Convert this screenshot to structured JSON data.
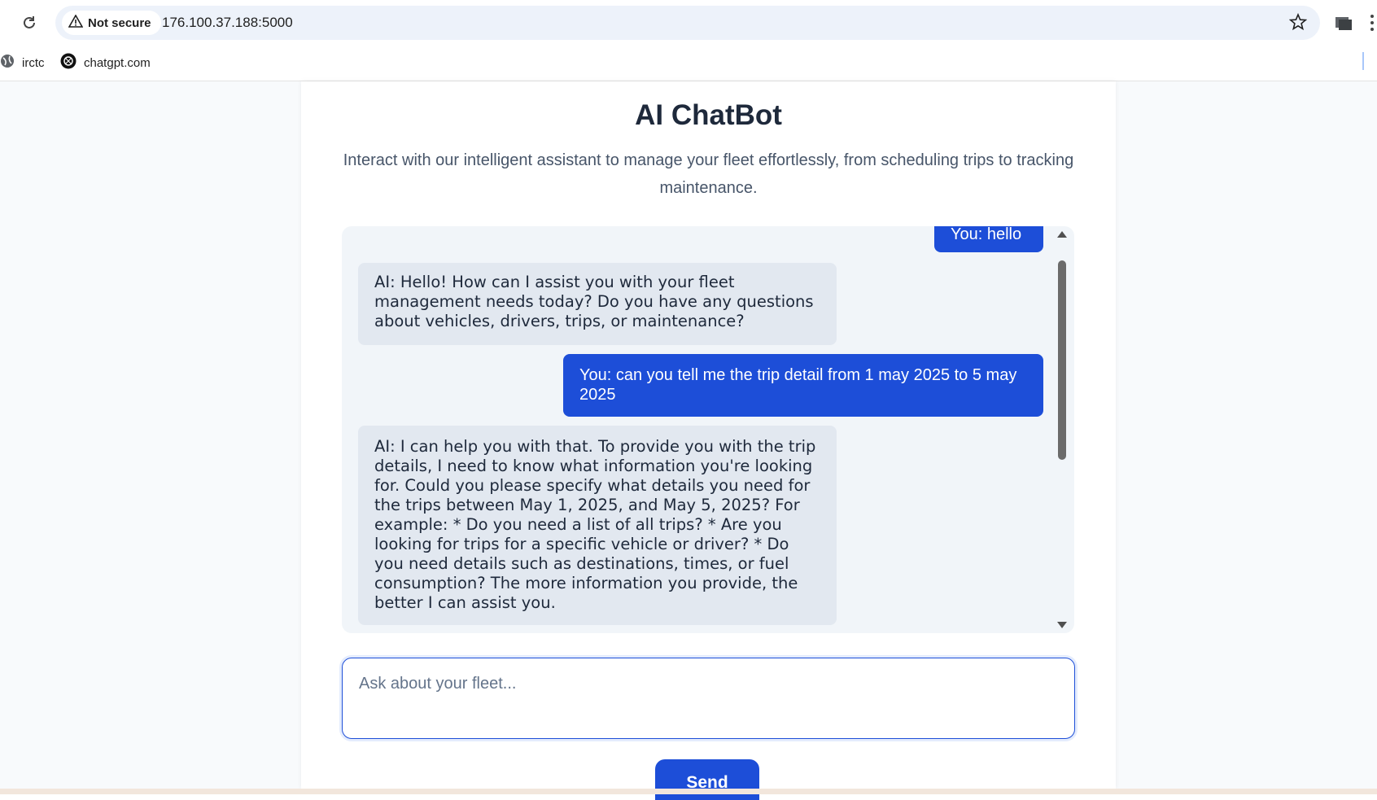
{
  "browser": {
    "security_label": "Not secure",
    "url": "176.100.37.188:5000",
    "bookmarks": [
      {
        "label": "irctc",
        "icon": "globe-icon"
      },
      {
        "label": "chatgpt.com",
        "icon": "chatgpt-icon"
      }
    ]
  },
  "page": {
    "title": "AI ChatBot",
    "subtitle": "Interact with our intelligent assistant to manage your fleet effortlessly, from scheduling trips to tracking maintenance."
  },
  "chat": {
    "messages": [
      {
        "role": "user",
        "text": "You: hello"
      },
      {
        "role": "ai",
        "text": "AI: Hello! How can I assist you with your fleet management needs today? Do you have any questions about vehicles, drivers, trips, or maintenance?"
      },
      {
        "role": "user",
        "text": "You: can you tell me the trip detail from 1 may 2025 to 5 may 2025"
      },
      {
        "role": "ai",
        "text": "AI: I can help you with that. To provide you with the trip details, I need to know what information you're looking for. Could you please specify what details you need for the trips between May 1, 2025, and May 5, 2025? For example: * Do you need a list of all trips? * Are you looking for trips for a specific vehicle or driver? * Do you need details such as destinations, times, or fuel consumption? The more information you provide, the better I can assist you."
      }
    ]
  },
  "composer": {
    "placeholder": "Ask about your fleet...",
    "send_label": "Send"
  },
  "colors": {
    "primary": "#1d4ed8",
    "ai_bubble": "#e2e8f0",
    "chat_bg": "#f1f5f9",
    "title": "#1e293b"
  }
}
